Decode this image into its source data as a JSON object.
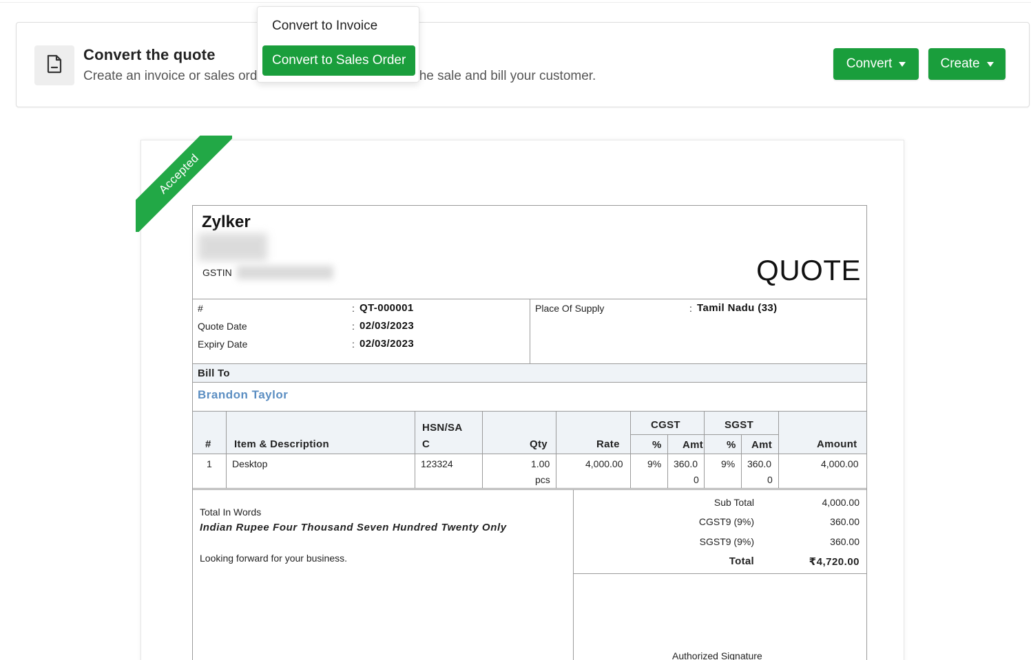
{
  "banner": {
    "title": "Convert the quote",
    "description": "Create an invoice or sales ord",
    "description_tail": "the sale and bill your customer.",
    "convert_label": "Convert",
    "create_label": "Create",
    "icon": "document-icon"
  },
  "dropdown": {
    "items": [
      {
        "label": "Convert to Invoice",
        "active": false
      },
      {
        "label": "Convert to Sales Order",
        "active": true
      }
    ]
  },
  "status_ribbon": "Accepted",
  "quote": {
    "company": "Zylker",
    "gstin_label": "GSTIN",
    "doc_title": "QUOTE",
    "fields": [
      {
        "label": "#",
        "value": "QT-000001"
      },
      {
        "label": "Quote Date",
        "value": "02/03/2023"
      },
      {
        "label": "Expiry Date",
        "value": "02/03/2023"
      }
    ],
    "place_of_supply_label": "Place Of Supply",
    "place_of_supply_value": "Tamil Nadu (33)",
    "colon": ":",
    "bill_to_label": "Bill To",
    "customer": "Brandon Taylor",
    "table": {
      "headers": {
        "num": "#",
        "item": "Item & Description",
        "hsn_line1": "HSN/SA",
        "hsn_line2": "C",
        "qty": "Qty",
        "rate": "Rate",
        "cgst": "CGST",
        "sgst": "SGST",
        "pct": "%",
        "amt": "Amt",
        "amount": "Amount"
      },
      "rows": [
        {
          "num": "1",
          "item": "Desktop",
          "hsn": "123324",
          "qty": "1.00",
          "unit": "pcs",
          "rate": "4,000.00",
          "cgst_pct": "9%",
          "cgst_amt_line1": "360.0",
          "cgst_amt_line2": "0",
          "sgst_pct": "9%",
          "sgst_amt_line1": "360.0",
          "sgst_amt_line2": "0",
          "amount": "4,000.00"
        }
      ]
    },
    "total_in_words_label": "Total In Words",
    "total_in_words": "Indian Rupee Four Thousand Seven Hundred Twenty Only",
    "notes": "Looking forward for your business.",
    "totals": [
      {
        "label": "Sub Total",
        "value": "4,000.00"
      },
      {
        "label": "CGST9 (9%)",
        "value": "360.00"
      },
      {
        "label": "SGST9 (9%)",
        "value": "360.00"
      }
    ],
    "total_label": "Total",
    "total_value": "₹4,720.00",
    "signature_label": "Authorized Signature"
  },
  "colors": {
    "accent_green": "#1a9e3c",
    "customer_link": "#5b8ec2",
    "table_header_bg": "#eff3f7"
  }
}
